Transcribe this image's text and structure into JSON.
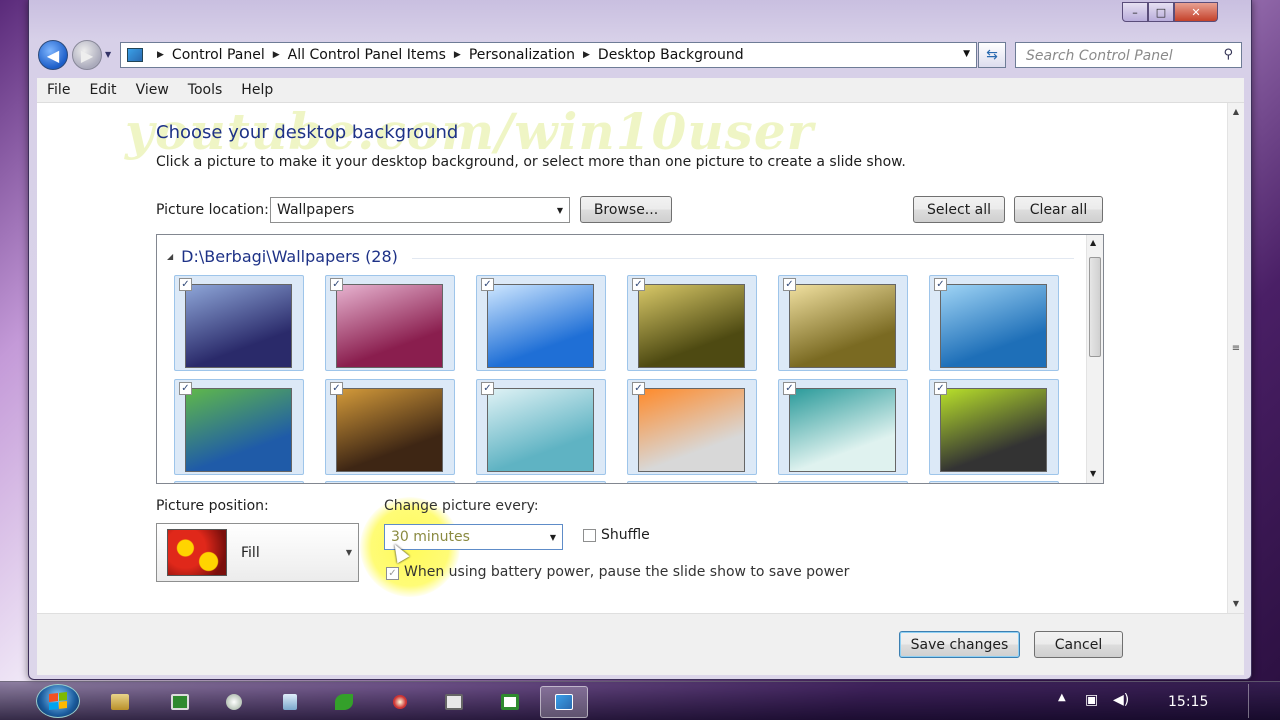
{
  "window": {
    "caption_buttons": [
      "–",
      "□",
      "✕"
    ]
  },
  "address_bar": {
    "breadcrumbs": [
      "Control Panel",
      "All Control Panel Items",
      "Personalization",
      "Desktop Background"
    ]
  },
  "search": {
    "placeholder": "Search Control Panel"
  },
  "menu": [
    "File",
    "Edit",
    "View",
    "Tools",
    "Help"
  ],
  "watermark": "youtube.com/win10user",
  "page": {
    "title": "Choose your desktop background",
    "subtitle": "Click a picture to make it your desktop background, or select more than one picture to create a slide show."
  },
  "picture_location": {
    "label": "Picture location:",
    "value": "Wallpapers",
    "browse_label": "Browse..."
  },
  "select_all_label": "Select all",
  "clear_all_label": "Clear all",
  "gallery": {
    "group_header": "D:\\Berbagi\\Wallpapers (28)",
    "thumbnails": [
      {
        "checked": true,
        "colors": [
          "#2a2a6a",
          "#8ea6d8"
        ]
      },
      {
        "checked": true,
        "colors": [
          "#8a1e4e",
          "#e7b3d0"
        ]
      },
      {
        "checked": true,
        "colors": [
          "#1f6fd6",
          "#cde6ff"
        ]
      },
      {
        "checked": true,
        "colors": [
          "#4e4a12",
          "#d8c868"
        ]
      },
      {
        "checked": true,
        "colors": [
          "#7a6a22",
          "#f0e0a0"
        ]
      },
      {
        "checked": true,
        "colors": [
          "#1e6fb8",
          "#9fd4f5"
        ]
      },
      {
        "checked": true,
        "colors": [
          "#1f5ba8",
          "#5fb84a"
        ]
      },
      {
        "checked": true,
        "colors": [
          "#3e2614",
          "#d39a3a"
        ]
      },
      {
        "checked": true,
        "colors": [
          "#5fb3c3",
          "#dff2f5"
        ]
      },
      {
        "checked": true,
        "colors": [
          "#d8d8d8",
          "#ff8a2a"
        ]
      },
      {
        "checked": true,
        "colors": [
          "#dff2ef",
          "#2a9a9a"
        ]
      },
      {
        "checked": true,
        "colors": [
          "#333333",
          "#b8e02a"
        ]
      }
    ]
  },
  "picture_position": {
    "label": "Picture position:",
    "value": "Fill"
  },
  "change_picture": {
    "label": "Change picture every:",
    "value": "30 minutes"
  },
  "shuffle_label": "Shuffle",
  "battery_label": "When using battery power, pause the slide show to save power",
  "buttons": {
    "save": "Save changes",
    "cancel": "Cancel"
  },
  "taskbar": {
    "clock": "15:15"
  }
}
